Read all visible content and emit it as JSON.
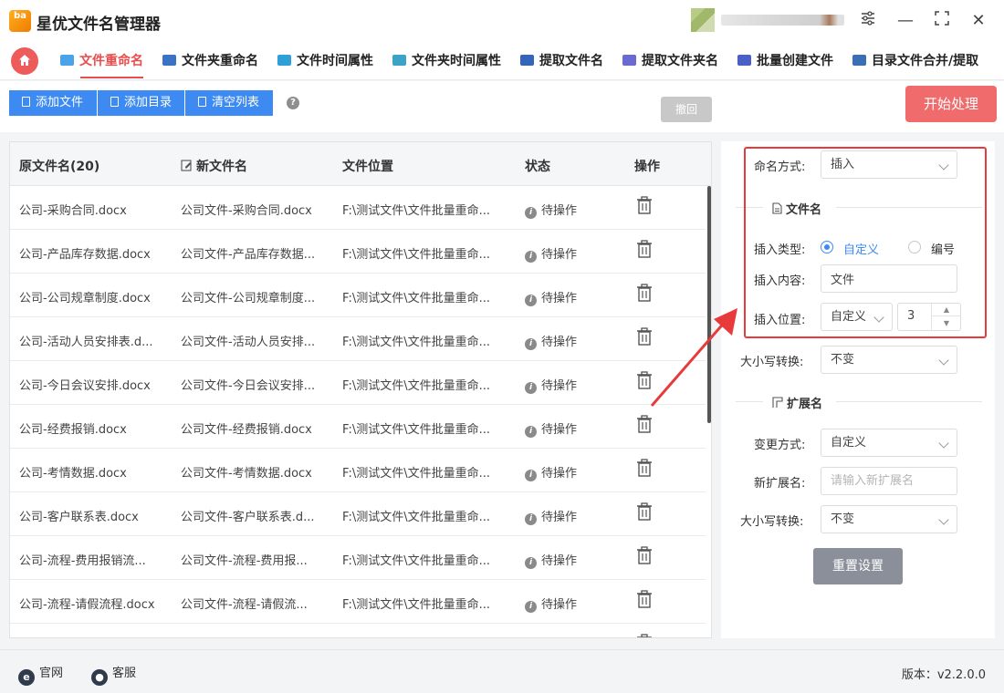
{
  "app": {
    "title": "星优文件名管理器",
    "logo_text": "ba"
  },
  "window": {
    "settings": "⚙",
    "minimize": "—",
    "maximize": "⛶",
    "close": "✕"
  },
  "nav": {
    "tabs": [
      {
        "label": "文件重命名",
        "color": "#4aa3e8"
      },
      {
        "label": "文件夹重命名",
        "color": "#3b73c4"
      },
      {
        "label": "文件时间属性",
        "color": "#2f9fd8"
      },
      {
        "label": "文件夹时间属性",
        "color": "#3aa3c6"
      },
      {
        "label": "提取文件名",
        "color": "#3565b8"
      },
      {
        "label": "提取文件夹名",
        "color": "#6a6ad0"
      },
      {
        "label": "批量创建文件",
        "color": "#4b5fc9"
      },
      {
        "label": "目录文件合并/提取",
        "color": "#3a6fb5"
      }
    ]
  },
  "toolbar": {
    "add_file": "添加文件",
    "add_dir": "添加目录",
    "clear_list": "清空列表",
    "help": "?",
    "undo": "撤回",
    "start": "开始处理"
  },
  "table": {
    "headers": {
      "orig": "原文件名(20)",
      "new": "新文件名",
      "loc": "文件位置",
      "status": "状态",
      "op": "操作"
    },
    "rows": [
      {
        "orig": "公司-采购合同.docx",
        "new": "公司文件-采购合同.docx",
        "loc": "F:\\测试文件\\文件批量重命...",
        "status": "待操作"
      },
      {
        "orig": "公司-产品库存数据.docx",
        "new": "公司文件-产品库存数据...",
        "loc": "F:\\测试文件\\文件批量重命...",
        "status": "待操作"
      },
      {
        "orig": "公司-公司规章制度.docx",
        "new": "公司文件-公司规章制度...",
        "loc": "F:\\测试文件\\文件批量重命...",
        "status": "待操作"
      },
      {
        "orig": "公司-活动人员安排表.d...",
        "new": "公司文件-活动人员安排...",
        "loc": "F:\\测试文件\\文件批量重命...",
        "status": "待操作"
      },
      {
        "orig": "公司-今日会议安排.docx",
        "new": "公司文件-今日会议安排...",
        "loc": "F:\\测试文件\\文件批量重命...",
        "status": "待操作"
      },
      {
        "orig": "公司-经费报销.docx",
        "new": "公司文件-经费报销.docx",
        "loc": "F:\\测试文件\\文件批量重命...",
        "status": "待操作"
      },
      {
        "orig": "公司-考情数据.docx",
        "new": "公司文件-考情数据.docx",
        "loc": "F:\\测试文件\\文件批量重命...",
        "status": "待操作"
      },
      {
        "orig": "公司-客户联系表.docx",
        "new": "公司文件-客户联系表.d...",
        "loc": "F:\\测试文件\\文件批量重命...",
        "status": "待操作"
      },
      {
        "orig": "公司-流程-费用报销流...",
        "new": "公司文件-流程-费用报...",
        "loc": "F:\\测试文件\\文件批量重命...",
        "status": "待操作"
      },
      {
        "orig": "公司-流程-请假流程.docx",
        "new": "公司文件-流程-请假流...",
        "loc": "F:\\测试文件\\文件批量重命...",
        "status": "待操作"
      }
    ]
  },
  "settings": {
    "naming_label": "命名方式:",
    "naming_value": "插入",
    "filename_section": "文件名",
    "insert_type_label": "插入类型:",
    "insert_type_custom": "自定义",
    "insert_type_number": "编号",
    "insert_content_label": "插入内容:",
    "insert_content_value": "文件",
    "insert_pos_label": "插入位置:",
    "insert_pos_value": "自定义",
    "insert_pos_number": "3",
    "case_label": "大小写转换:",
    "case_value": "不变",
    "ext_section": "扩展名",
    "change_label": "变更方式:",
    "change_value": "自定义",
    "new_ext_label": "新扩展名:",
    "new_ext_placeholder": "请输入新扩展名",
    "ext_case_label": "大小写转换:",
    "ext_case_value": "不变",
    "reset": "重置设置"
  },
  "footer": {
    "website": "官网",
    "support": "客服",
    "version": "版本：v2.2.0.0"
  }
}
